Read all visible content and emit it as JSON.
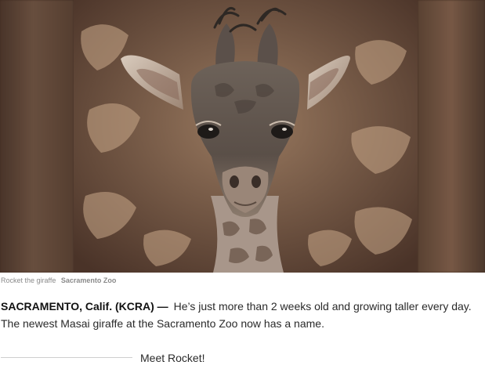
{
  "photo": {
    "subject_icon": "giraffe-photo",
    "colors": {
      "background_dark": "#3e2a1f",
      "fur_light": "#c9b8a3",
      "spots": "#6b4a34"
    }
  },
  "caption": {
    "text": "Rocket the giraffe",
    "credit": "Sacramento Zoo"
  },
  "article": {
    "dateline": "SACRAMENTO, Calif. (KCRA) —",
    "lead": "He’s just more than 2 weeks old and growing taller every day. The newest Masai giraffe at the Sacramento Zoo now has a name."
  },
  "section": {
    "subheading": "Meet Rocket!"
  }
}
